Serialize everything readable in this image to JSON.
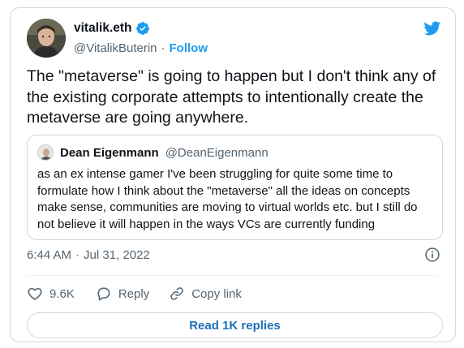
{
  "author": {
    "display_name": "vitalik.eth",
    "handle": "@VitalikButerin",
    "separator": "·",
    "follow_label": "Follow"
  },
  "tweet": {
    "text": "The \"metaverse\" is going to happen but I don't think any of the existing corporate attempts to intentionally create the metaverse are going anywhere."
  },
  "quoted": {
    "display_name": "Dean Eigenmann",
    "handle": "@DeanEigenmann",
    "text": "as an ex intense gamer I've been struggling for quite some time to formulate how I think about the \"metaverse\" all the ideas on concepts make sense, communities are moving to virtual worlds etc. but I still do not believe it will happen in the ways VCs are currently funding"
  },
  "meta": {
    "time": "6:44 AM",
    "separator": "·",
    "date": "Jul 31, 2022"
  },
  "actions": {
    "likes_count": "9.6K",
    "reply_label": "Reply",
    "copy_link_label": "Copy link"
  },
  "replies_button_label": "Read 1K replies",
  "colors": {
    "accent": "#1d9bf0",
    "link_button_text": "#1d6fb8",
    "secondary_text": "#536471",
    "border": "#cfd9de"
  },
  "icons": [
    "verified-badge-icon",
    "twitter-bird-icon",
    "info-icon",
    "heart-icon",
    "reply-bubble-icon",
    "link-icon"
  ]
}
